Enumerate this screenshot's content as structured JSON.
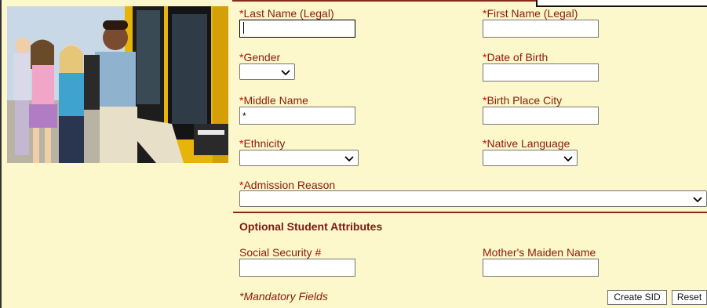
{
  "form": {
    "required_marker": "*",
    "fields": {
      "last_name": {
        "label": "Last Name (Legal)",
        "value": ""
      },
      "first_name": {
        "label": "First Name (Legal)",
        "value": ""
      },
      "gender": {
        "label": "Gender",
        "value": ""
      },
      "date_of_birth": {
        "label": "Date of Birth",
        "value": ""
      },
      "middle_name": {
        "label": "Middle Name",
        "value": "*"
      },
      "birth_place_city": {
        "label": "Birth Place City",
        "value": ""
      },
      "ethnicity": {
        "label": "Ethnicity",
        "value": ""
      },
      "native_language": {
        "label": "Native Language",
        "value": ""
      },
      "admission_reason": {
        "label": "Admission Reason",
        "value": ""
      }
    },
    "optional_section": {
      "title": "Optional Student Attributes",
      "social_security": {
        "label": "Social Security #",
        "value": ""
      },
      "mothers_maiden_name": {
        "label": "Mother's Maiden Name",
        "value": ""
      }
    },
    "mandatory_note": "*Mandatory Fields",
    "buttons": {
      "create_sid": "Create SID",
      "reset": "Reset"
    }
  },
  "colors": {
    "background": "#fdf7cc",
    "label": "#8b1a0c",
    "required": "#e00000",
    "divider": "#8b2a1c"
  },
  "icons": {
    "dropdown": "chevron-down-icon"
  }
}
